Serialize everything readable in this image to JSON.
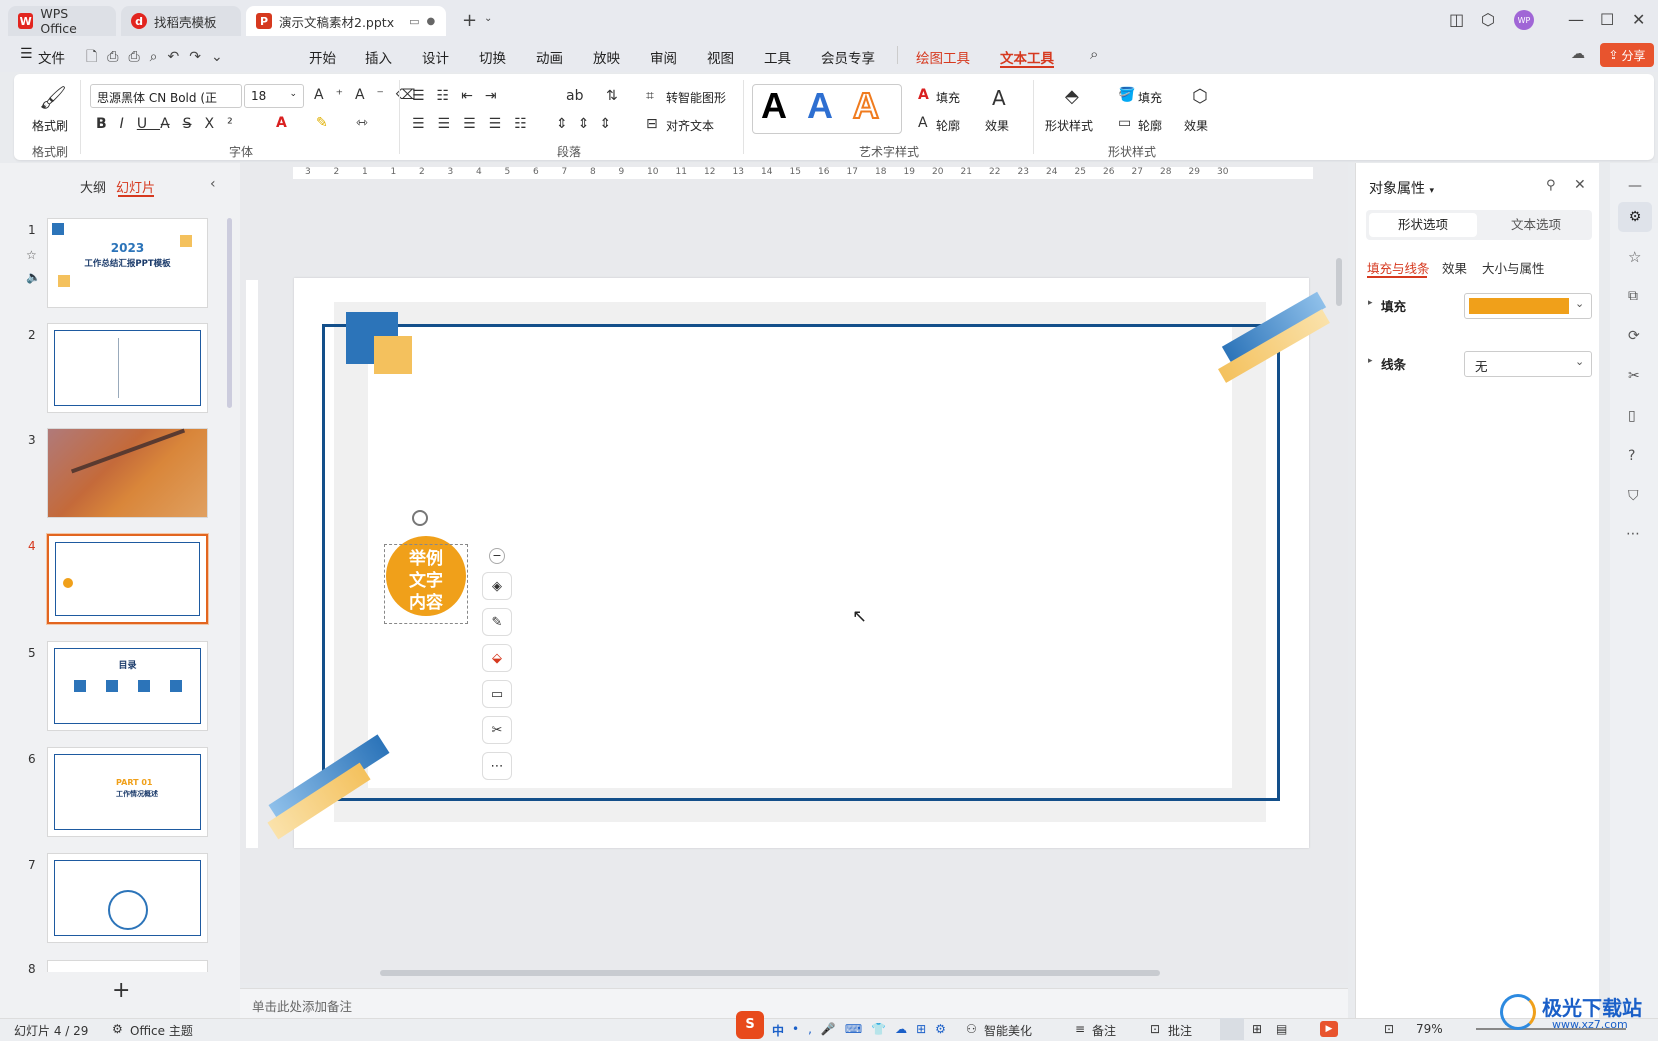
{
  "tabs": [
    {
      "label": "WPS Office"
    },
    {
      "label": "找稻壳模板"
    },
    {
      "label": "演示文稿素材2.pptx"
    }
  ],
  "menu": {
    "file": "文件",
    "items": [
      "开始",
      "插入",
      "设计",
      "切换",
      "动画",
      "放映",
      "审阅",
      "视图",
      "工具",
      "会员专享"
    ],
    "context_tools": [
      "绘图工具",
      "文本工具"
    ],
    "share": "分享"
  },
  "ribbon": {
    "format_painter": "格式刷",
    "group_format_painter": "格式刷",
    "font_name": "思源黑体 CN Bold (正",
    "font_size": "18",
    "group_font": "字体",
    "group_paragraph": "段落",
    "smart_shape": "转智能图形",
    "align_text": "对齐文本",
    "group_art": "艺术字样式",
    "fill": "填充",
    "outline": "轮廓",
    "effect": "效果",
    "shape_style": "形状样式",
    "fill2": "填充",
    "outline2": "轮廓",
    "effect2": "效果",
    "group_shape": "形状样式"
  },
  "left_panel": {
    "tab_outline": "大纲",
    "tab_slides": "幻灯片",
    "slide_numbers": [
      "1",
      "2",
      "3",
      "4",
      "5",
      "6",
      "7",
      "8"
    ],
    "slide1_year": "2023",
    "slide1_title": "工作总结汇报PPT模板",
    "slide5_title": "目录",
    "slide6_part": "PART 01",
    "slide6_title": "工作情况概述"
  },
  "ruler_h": [
    "3",
    "2",
    "1",
    "1",
    "2",
    "3",
    "4",
    "5",
    "6",
    "7",
    "8",
    "9",
    "10",
    "11",
    "12",
    "13",
    "14",
    "15",
    "16",
    "17",
    "18",
    "19",
    "20",
    "21",
    "22",
    "23",
    "24",
    "25",
    "26",
    "27",
    "28",
    "29",
    "30"
  ],
  "slide": {
    "shape_text": [
      "举例",
      "文字",
      "内容"
    ]
  },
  "notes_placeholder": "单击此处添加备注",
  "right_panel": {
    "title": "对象属性",
    "tab_shape": "形状选项",
    "tab_text": "文本选项",
    "sub_fill_line": "填充与线条",
    "sub_effect": "效果",
    "sub_size": "大小与属性",
    "fill_label": "填充",
    "line_label": "线条",
    "line_value": "无",
    "fill_color": "#f0a01a"
  },
  "status": {
    "slide_count": "幻灯片 4 / 29",
    "theme": "Office 主题",
    "ime": "中",
    "beautify": "智能美化",
    "notes": "备注",
    "comments": "批注",
    "zoom": "79%"
  },
  "watermark": {
    "text": "极光下载站",
    "url": "www.xz7.com"
  },
  "colors": {
    "accent": "#d6391f",
    "blue": "#2c74b9",
    "yellow": "#f4c15d",
    "frame": "#134f8a",
    "orange": "#f0a01a"
  }
}
